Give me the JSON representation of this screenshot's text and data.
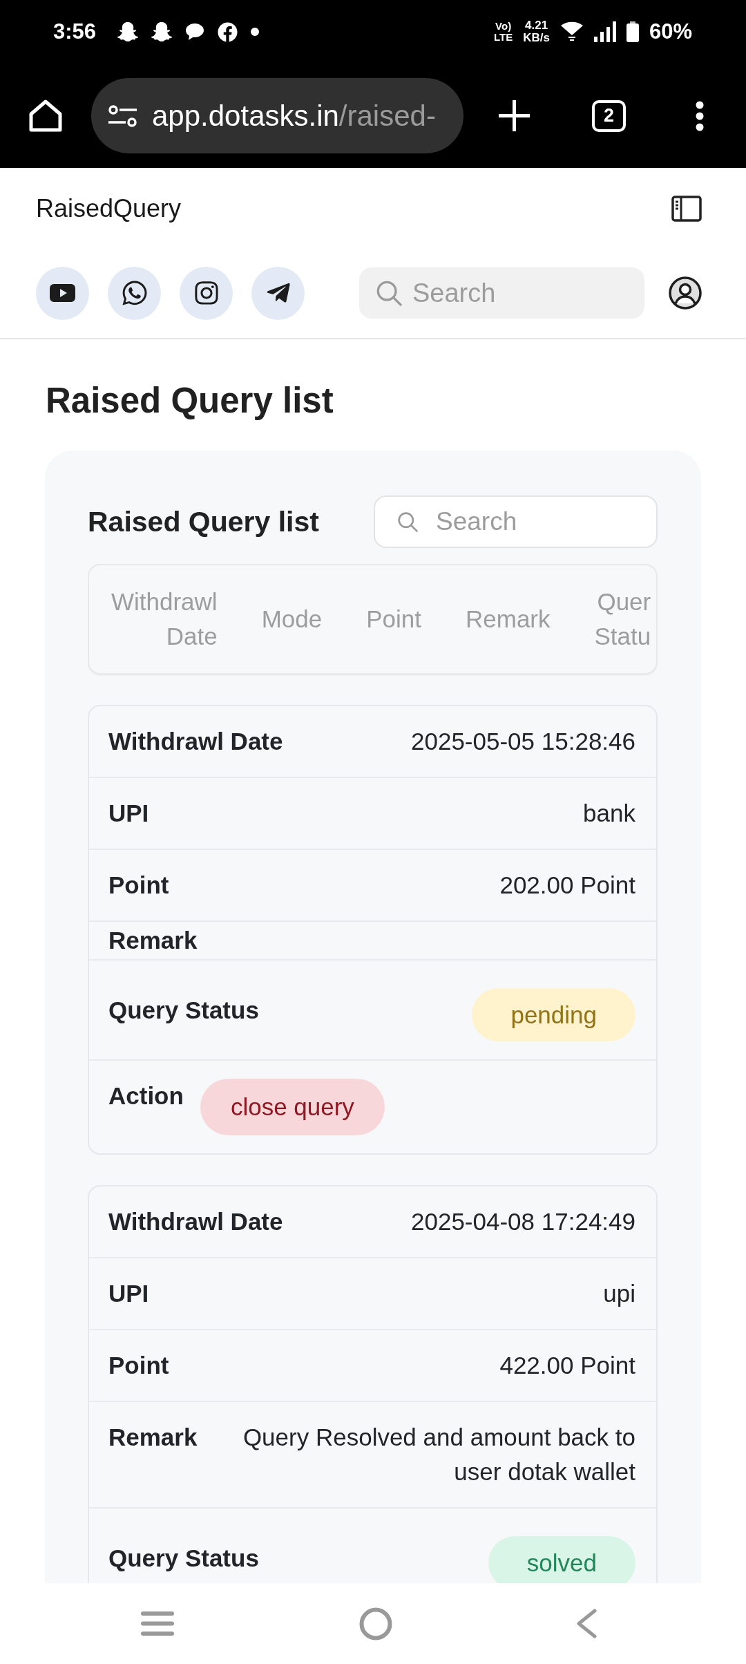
{
  "status_bar": {
    "time": "3:56",
    "network": [
      "Vo)",
      "LTE"
    ],
    "speed": [
      "4.21",
      "KB/s"
    ],
    "battery": "60%"
  },
  "browser": {
    "url_host": "app.dotasks.in",
    "url_path": "/raised-",
    "tab_count": "2"
  },
  "header": {
    "title": "RaisedQuery",
    "search": {
      "placeholder": "Search"
    }
  },
  "page_title": "Raised Query list",
  "panel": {
    "title": "Raised Query list",
    "search": {
      "placeholder": "Search"
    },
    "table": {
      "columns": [
        "Withdrawl Date",
        "Mode",
        "Point",
        "Remark",
        "Quer Statu"
      ]
    },
    "records": [
      {
        "fields": [
          {
            "kind": "text",
            "label": "Withdrawl Date",
            "value": "2025-05-05 15:28:46"
          },
          {
            "kind": "text",
            "label": "UPI",
            "value": "bank"
          },
          {
            "kind": "text",
            "label": "Point",
            "value": "202.00 Point"
          },
          {
            "kind": "text",
            "label": "Remark"
          },
          {
            "kind": "badge",
            "label": "Query Status",
            "value": "pending",
            "color": "#fff3cd"
          },
          {
            "kind": "button",
            "label": "Action",
            "value": "close query",
            "color": "#f8d7da"
          }
        ]
      },
      {
        "fields": [
          {
            "kind": "text",
            "label": "Withdrawl Date",
            "value": "2025-04-08 17:24:49"
          },
          {
            "kind": "text",
            "label": "UPI",
            "value": "upi"
          },
          {
            "kind": "text",
            "label": "Point",
            "value": "422.00 Point"
          },
          {
            "kind": "text",
            "label": "Remark",
            "value": "Query Resolved and amount back to user dotak wallet"
          },
          {
            "kind": "badge",
            "label": "Query Status",
            "value": "solved",
            "color": "#d8f5e8"
          }
        ]
      }
    ]
  }
}
